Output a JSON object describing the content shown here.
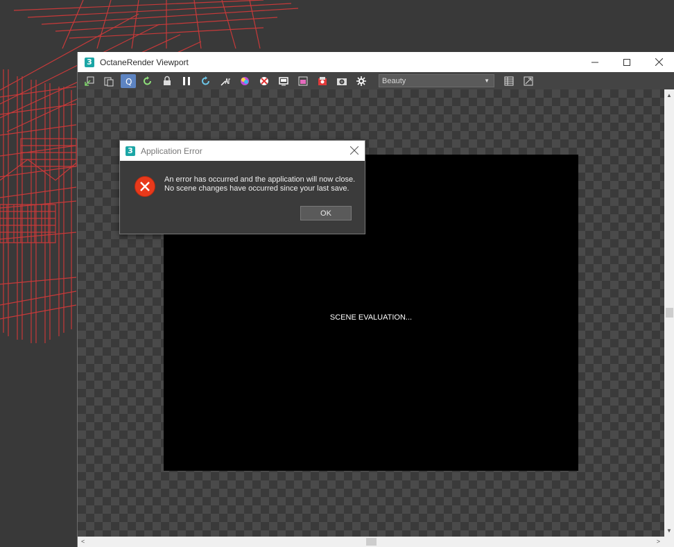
{
  "octane_window": {
    "title": "OctaneRender Viewport",
    "app_icon_glyph": "3",
    "controls": [
      "minimize-icon",
      "maximize-icon",
      "close-icon"
    ]
  },
  "toolbar": {
    "buttons": [
      "send-scene-icon",
      "clipboard-icon",
      "quick-render-icon",
      "restart-render-icon",
      "lock-icon",
      "pause-icon",
      "refresh-icon",
      "focus-picker-icon",
      "material-picker-icon",
      "object-picker-icon",
      "region-render-icon",
      "film-region-icon",
      "camera-picker-icon",
      "screenshot-icon",
      "settings-gear-icon"
    ],
    "active_button": "quick-render-icon",
    "active_glyph": "Q",
    "pass_select": {
      "value": "Beauty"
    },
    "right_buttons": [
      "table-icon",
      "image-export-icon"
    ]
  },
  "render": {
    "status_text": "SCENE EVALUATION..."
  },
  "error_dialog": {
    "title": "Application Error",
    "app_icon_glyph": "3",
    "message_line1": "An error has occurred and the application will now close.",
    "message_line2": "No scene changes have occurred since your last save.",
    "ok_label": "OK"
  },
  "colors": {
    "accent_blue": "#5d84c2",
    "error_red": "#e8391b",
    "wireframe_red": "#d32f2f",
    "app_teal": "#1ba6a6"
  }
}
